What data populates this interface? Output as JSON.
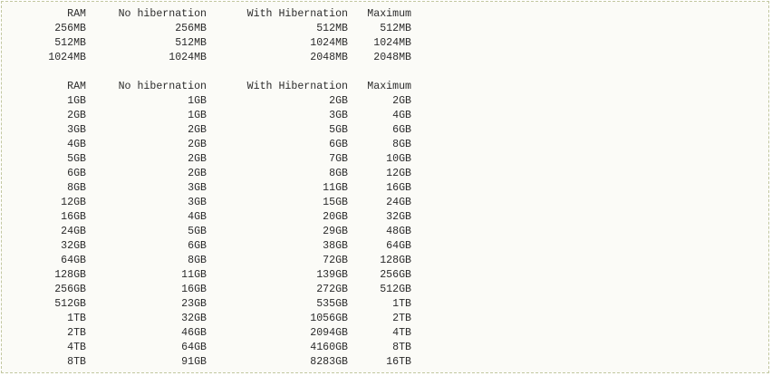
{
  "tables": [
    {
      "headers": [
        "RAM",
        "No hibernation",
        "With Hibernation",
        "Maximum"
      ],
      "rows": [
        [
          "256MB",
          "256MB",
          "512MB",
          "512MB"
        ],
        [
          "512MB",
          "512MB",
          "1024MB",
          "1024MB"
        ],
        [
          "1024MB",
          "1024MB",
          "2048MB",
          "2048MB"
        ]
      ]
    },
    {
      "headers": [
        "RAM",
        "No hibernation",
        "With Hibernation",
        "Maximum"
      ],
      "rows": [
        [
          "1GB",
          "1GB",
          "2GB",
          "2GB"
        ],
        [
          "2GB",
          "1GB",
          "3GB",
          "4GB"
        ],
        [
          "3GB",
          "2GB",
          "5GB",
          "6GB"
        ],
        [
          "4GB",
          "2GB",
          "6GB",
          "8GB"
        ],
        [
          "5GB",
          "2GB",
          "7GB",
          "10GB"
        ],
        [
          "6GB",
          "2GB",
          "8GB",
          "12GB"
        ],
        [
          "8GB",
          "3GB",
          "11GB",
          "16GB"
        ],
        [
          "12GB",
          "3GB",
          "15GB",
          "24GB"
        ],
        [
          "16GB",
          "4GB",
          "20GB",
          "32GB"
        ],
        [
          "24GB",
          "5GB",
          "29GB",
          "48GB"
        ],
        [
          "32GB",
          "6GB",
          "38GB",
          "64GB"
        ],
        [
          "64GB",
          "8GB",
          "72GB",
          "128GB"
        ],
        [
          "128GB",
          "11GB",
          "139GB",
          "256GB"
        ],
        [
          "256GB",
          "16GB",
          "272GB",
          "512GB"
        ],
        [
          "512GB",
          "23GB",
          "535GB",
          "1TB"
        ],
        [
          "1TB",
          "32GB",
          "1056GB",
          "2TB"
        ],
        [
          "2TB",
          "46GB",
          "2094GB",
          "4TB"
        ],
        [
          "4TB",
          "64GB",
          "4160GB",
          "8TB"
        ],
        [
          "8TB",
          "91GB",
          "8283GB",
          "16TB"
        ]
      ]
    }
  ]
}
